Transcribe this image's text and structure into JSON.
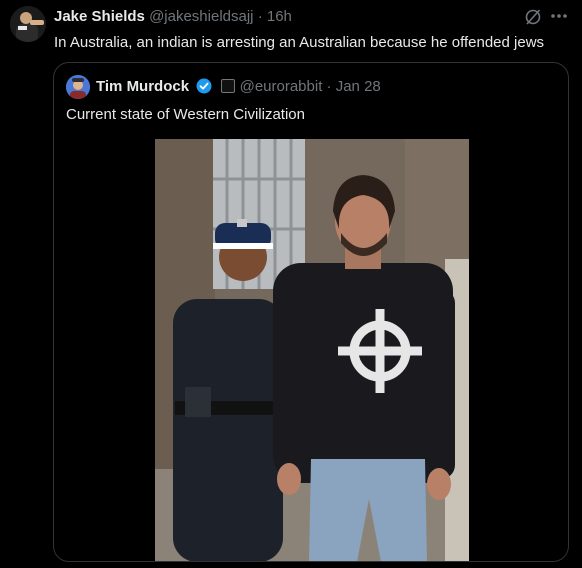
{
  "tweet": {
    "author_name": "Jake Shields",
    "author_handle": "@jakeshieldsajj",
    "separator": "·",
    "time": "16h",
    "text": "In Australia, an indian is arresting an Australian because he offended jews"
  },
  "quote": {
    "author_name": "Tim Murdock",
    "author_handle": "@eurorabbit",
    "separator": "·",
    "date": "Jan 28",
    "text": "Current state of Western Civilization"
  },
  "icons": {
    "grok": "grok-icon",
    "more": "more-options-icon",
    "verified": "verified-badge-icon",
    "affiliate": "affiliate-badge-icon"
  },
  "colors": {
    "background": "#000000",
    "text": "#e7e9ea",
    "muted": "#71767b",
    "border": "#2f3336",
    "verified": "#1d9bf0"
  }
}
